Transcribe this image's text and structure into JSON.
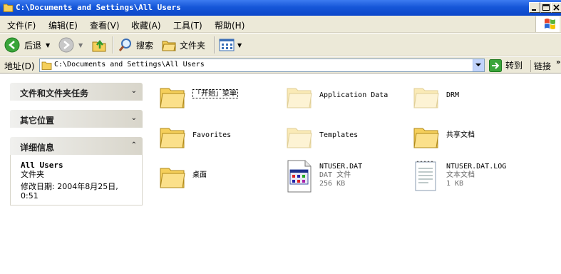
{
  "window": {
    "title": "C:\\Documents and Settings\\All Users"
  },
  "menu": {
    "items": [
      "文件(F)",
      "编辑(E)",
      "查看(V)",
      "收藏(A)",
      "工具(T)",
      "帮助(H)"
    ]
  },
  "toolbar": {
    "back_label": "后退",
    "search_label": "搜索",
    "folders_label": "文件夹"
  },
  "address": {
    "label": "地址(D)",
    "value": "C:\\Documents and Settings\\All Users",
    "go_label": "转到",
    "links_label": "链接"
  },
  "left_pane": {
    "tasks_title": "文件和文件夹任务",
    "other_places_title": "其它位置",
    "details_title": "详细信息",
    "details": {
      "name": "All Users",
      "type": "文件夹",
      "modified_label": "修改日期: 2004年8月25日,",
      "modified_time": "0:51"
    }
  },
  "files": [
    {
      "name": "「开始」菜单",
      "kind": "folder",
      "faded": false
    },
    {
      "name": "Application Data",
      "kind": "folder",
      "faded": true
    },
    {
      "name": "DRM",
      "kind": "folder",
      "faded": true
    },
    {
      "name": "Favorites",
      "kind": "folder",
      "faded": false
    },
    {
      "name": "Templates",
      "kind": "folder",
      "faded": true
    },
    {
      "name": "共享文档",
      "kind": "folder",
      "faded": false
    },
    {
      "name": "桌面",
      "kind": "folder",
      "faded": false
    },
    {
      "name": "NTUSER.DAT",
      "kind": "dat",
      "type": "DAT 文件",
      "size": "256 KB"
    },
    {
      "name": "NTUSER.DAT.LOG",
      "kind": "log",
      "type": "文本文档",
      "size": "1 KB"
    }
  ],
  "colors": {
    "titlebar": "#0b46c9",
    "chrome": "#ece9d8",
    "folder": "#f5cf5b",
    "folder_faded": "#faeab6"
  }
}
